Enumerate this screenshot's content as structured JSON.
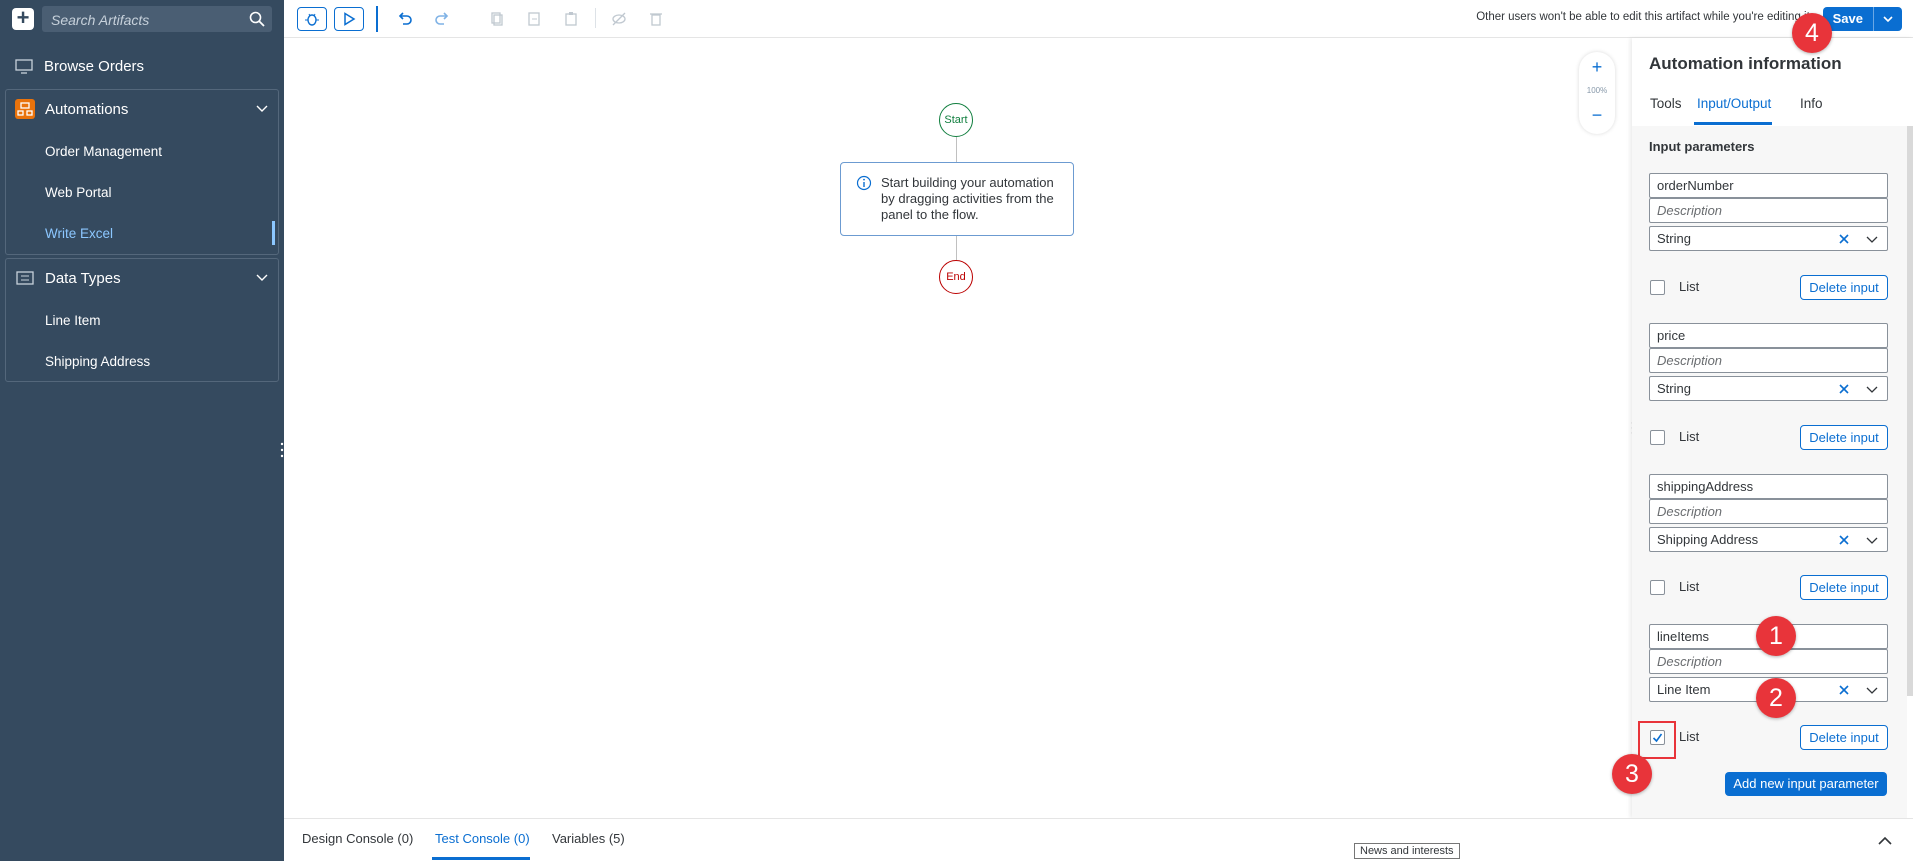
{
  "sidebar": {
    "search_placeholder": "Search Artifacts",
    "browse": "Browse Orders",
    "automations": {
      "label": "Automations",
      "items": [
        "Order Management",
        "Web Portal",
        "Write Excel"
      ]
    },
    "data_types": {
      "label": "Data Types",
      "items": [
        "Line Item",
        "Shipping Address"
      ]
    }
  },
  "toolbar": {
    "lock_message": "Other users won't be able to edit this artifact while you're editing it.",
    "save": "Save"
  },
  "canvas": {
    "start": "Start",
    "end": "End",
    "hint": "Start building your automation by dragging activities from the panel to the flow.",
    "zoom": "100%"
  },
  "panel": {
    "title": "Automation information",
    "tabs": [
      "Tools",
      "Input/Output",
      "Info"
    ],
    "heading": "Input parameters",
    "description_placeholder": "Description",
    "list_label": "List",
    "delete_label": "Delete input",
    "add_label": "Add new input parameter",
    "params": [
      {
        "name": "orderNumber",
        "type": "String",
        "list": false
      },
      {
        "name": "price",
        "type": "String",
        "list": false
      },
      {
        "name": "shippingAddress",
        "type": "Shipping Address",
        "list": false
      },
      {
        "name": "lineItems",
        "type": "Line Item",
        "list": true
      }
    ]
  },
  "console": {
    "tabs": [
      "Design Console (0)",
      "Test Console (0)",
      "Variables (5)"
    ],
    "news": "News and interests"
  },
  "annotations": [
    "1",
    "2",
    "3",
    "4"
  ],
  "colors": {
    "sidebar": "#354a5f",
    "accent": "#0a6ed1",
    "start": "#107e3e",
    "end": "#bb0000",
    "badge": "#e8343a"
  }
}
